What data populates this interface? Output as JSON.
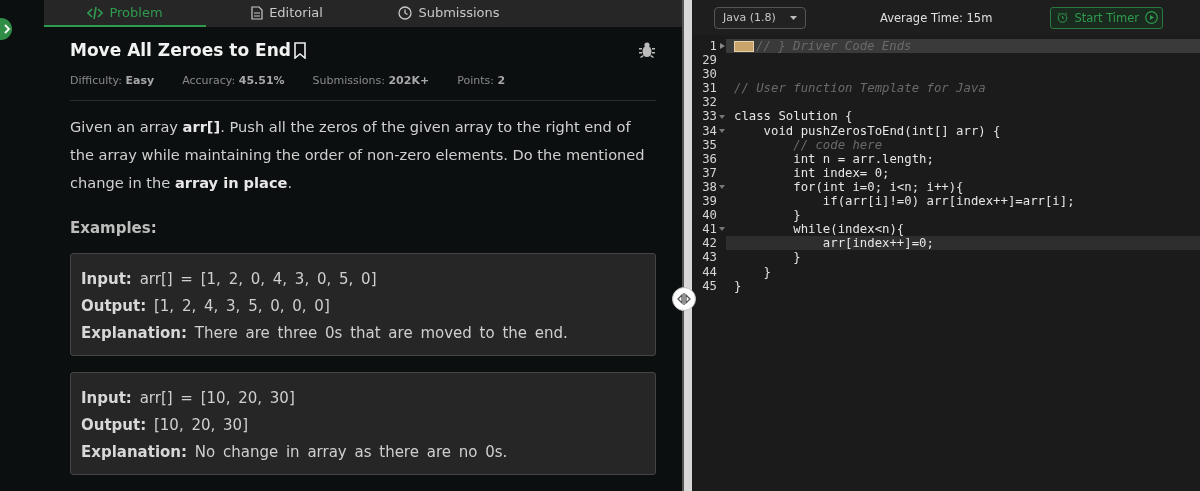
{
  "tabs": [
    {
      "label": "Problem",
      "selected": true
    },
    {
      "label": "Editorial",
      "selected": false
    },
    {
      "label": "Submissions",
      "selected": false
    }
  ],
  "problem": {
    "title": "Move All Zeroes to End",
    "meta": [
      "Difficulty: **Easy**",
      "Accuracy: **45.51%**",
      "Submissions: **202K+**",
      "Points: **2**"
    ],
    "description": "Given an array **arr[]**. Push all the zeros of the given array to the right end of the array while maintaining the order of non-zero elements. Do the mentioned change in the **array in place**.",
    "examples_heading": "Examples:",
    "examples": [
      {
        "lines": [
          "**Input:** arr[] = [1, 2, 0, 4, 3, 0, 5, 0]",
          "**Output:** [1, 2, 4, 3, 5, 0, 0, 0]",
          "**Explanation:** There are three 0s that are moved to the end."
        ]
      },
      {
        "lines": [
          "**Input:** arr[] = [10, 20, 30]",
          "**Output:** [10, 20, 30]",
          "**Explanation:** No change in array as there are no 0s."
        ]
      }
    ]
  },
  "editor": {
    "language": "Java (1.8)",
    "average_time": "Average Time: 15m",
    "timer_button": "Start Timer",
    "lines": [
      {
        "number": "1",
        "text": "// } Driver Code Ends",
        "kind": "comment",
        "foldable": true,
        "collapsed": true,
        "highlighted": true
      },
      {
        "number": "29",
        "kind": "code",
        "foldable": false,
        "collapsed": false,
        "highlighted": false
      },
      {
        "number": "30",
        "kind": "code",
        "foldable": false,
        "collapsed": false,
        "highlighted": false
      },
      {
        "number": "31",
        "text": "// User function Template for Java",
        "kind": "comment",
        "foldable": false,
        "collapsed": false,
        "highlighted": false
      },
      {
        "number": "32",
        "kind": "code",
        "foldable": false,
        "collapsed": false,
        "highlighted": false
      },
      {
        "number": "33",
        "text": "class Solution {",
        "kind": "code",
        "foldable": true,
        "collapsed": false,
        "highlighted": false
      },
      {
        "number": "34",
        "text": "    void pushZerosToEnd(int[] arr) {",
        "kind": "code",
        "foldable": true,
        "collapsed": false,
        "highlighted": false
      },
      {
        "number": "35",
        "text": "        // code here",
        "kind": "comment",
        "foldable": false,
        "collapsed": false,
        "highlighted": false
      },
      {
        "number": "36",
        "text": "        int n = arr.length;",
        "kind": "code",
        "foldable": false,
        "collapsed": false,
        "highlighted": false
      },
      {
        "number": "37",
        "text": "        int index= 0;",
        "kind": "code",
        "foldable": false,
        "collapsed": false,
        "highlighted": false
      },
      {
        "number": "38",
        "text": "        for(int i=0; i<n; i++){",
        "kind": "code",
        "foldable": true,
        "collapsed": false,
        "highlighted": false
      },
      {
        "number": "39",
        "text": "            if(arr[i]!=0) arr[index++]=arr[i];",
        "kind": "code",
        "foldable": false,
        "collapsed": false,
        "highlighted": false
      },
      {
        "number": "40",
        "text": "        }",
        "kind": "code",
        "foldable": false,
        "collapsed": false,
        "highlighted": false
      },
      {
        "number": "41",
        "text": "        while(index<n){",
        "kind": "code",
        "foldable": true,
        "collapsed": false,
        "highlighted": false
      },
      {
        "number": "42",
        "text": "            arr[index++]=0;",
        "kind": "code",
        "foldable": false,
        "collapsed": false,
        "highlighted": true
      },
      {
        "number": "43",
        "text": "        }",
        "kind": "code",
        "foldable": false,
        "collapsed": false,
        "highlighted": false
      },
      {
        "number": "44",
        "text": "    }",
        "kind": "code",
        "foldable": false,
        "collapsed": false,
        "highlighted": false
      },
      {
        "number": "45",
        "text": "}",
        "kind": "code",
        "foldable": false,
        "collapsed": false,
        "highlighted": false
      }
    ]
  }
}
